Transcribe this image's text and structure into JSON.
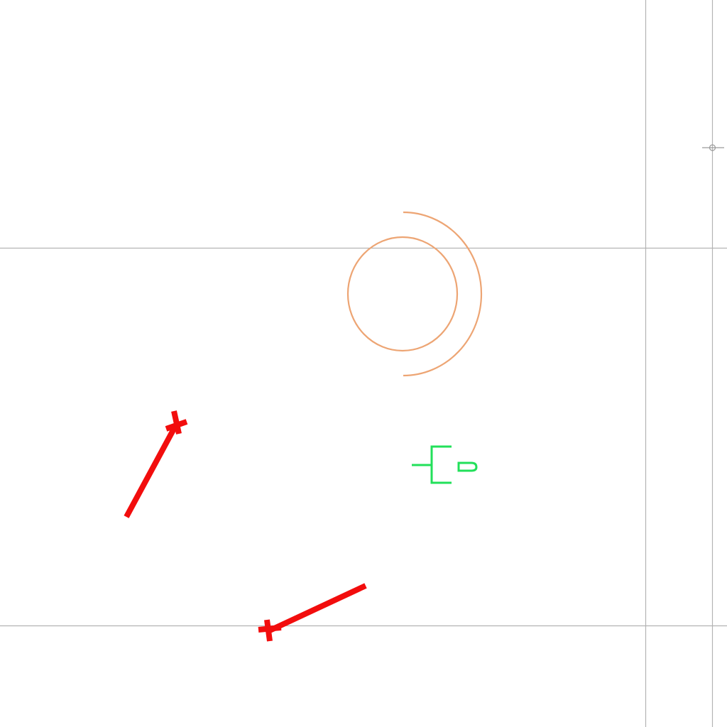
{
  "canvas": {
    "background": "#ffffff"
  },
  "colors": {
    "guide": "#b3b3b3",
    "arc": "#eda574",
    "red_marker": "#f20d0d",
    "green_glyph": "#22e05a"
  },
  "elements": {
    "guides": [
      "horizontal-guide-top",
      "horizontal-guide-bottom",
      "vertical-guide-left",
      "vertical-guide-right"
    ],
    "snap_marker": "crosshair-circle",
    "arcs": [
      "inner-circle",
      "outer-half-arc"
    ],
    "red_markers": [
      "pin-marker-upper",
      "pin-marker-lower"
    ],
    "green_glyph": "bracket-glyph"
  }
}
